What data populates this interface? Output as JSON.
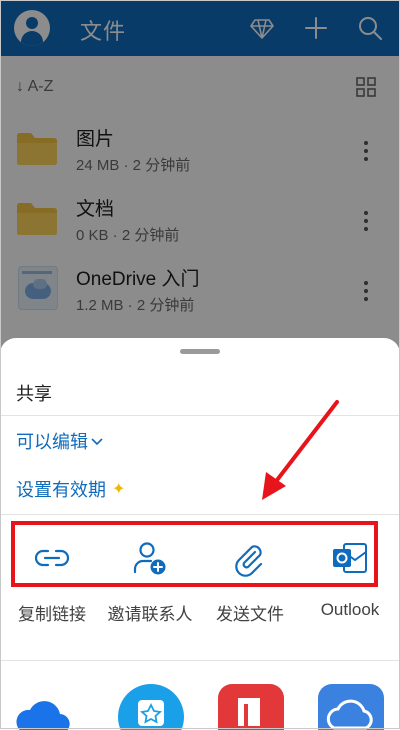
{
  "header": {
    "title": "文件",
    "icons": [
      "avatar",
      "premium-diamond-icon",
      "add-icon",
      "search-icon"
    ],
    "accent": "#0f6cbd"
  },
  "sort": {
    "label": "↓ A-Z"
  },
  "files": [
    {
      "name": "图片",
      "meta": "24 MB · 2 分钟前",
      "type": "folder"
    },
    {
      "name": "文档",
      "meta": "0 KB · 2 分钟前",
      "type": "folder"
    },
    {
      "name": "OneDrive 入门",
      "meta": "1.2 MB · 2 分钟前",
      "type": "document"
    }
  ],
  "share_sheet": {
    "title": "共享",
    "permission": "可以编辑",
    "expiry": "设置有效期",
    "actions": [
      {
        "label": "复制链接",
        "icon": "link-icon"
      },
      {
        "label": "邀请联系人",
        "icon": "add-person-icon"
      },
      {
        "label": "发送文件",
        "icon": "paperclip-icon"
      },
      {
        "label": "Outlook",
        "icon": "outlook-icon"
      }
    ],
    "apps": [
      "onedrive-app",
      "favorites-app",
      "wps-app",
      "cloud-app"
    ]
  },
  "annotation": {
    "highlight_color": "#e8141b"
  }
}
